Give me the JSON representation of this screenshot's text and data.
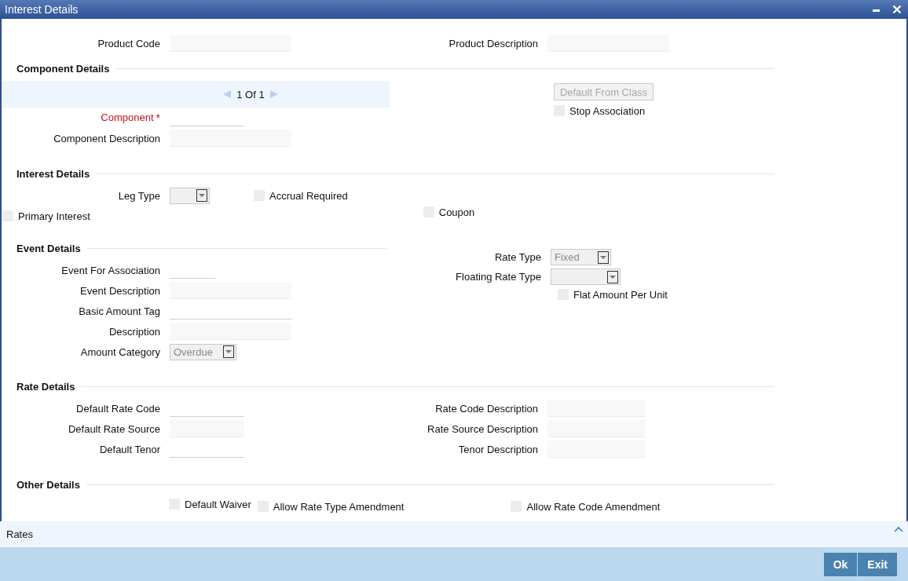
{
  "window": {
    "title": "Interest Details"
  },
  "product": [
    {
      "label": "Product Code",
      "kind": "readonly"
    },
    {
      "label": "Product Description",
      "kind": "readonly"
    }
  ],
  "component_details": {
    "heading": "Component Details",
    "pager": "1 Of 1",
    "fields": [
      {
        "label": "Component",
        "required_mark": "*",
        "kind": "text"
      },
      {
        "label": "Component Description",
        "kind": "readonly"
      }
    ],
    "button": {
      "label": "Default From Class",
      "disabled": true
    },
    "checkboxes": [
      {
        "label": "Stop Association",
        "checked": false
      }
    ]
  },
  "interest_details": {
    "heading": "Interest Details",
    "field": {
      "label": "Leg Type",
      "kind": "select",
      "disabled": true
    },
    "checkboxes": [
      {
        "label": "Accrual Required",
        "checked": false
      },
      {
        "label": "Primary Interest",
        "checked": false
      },
      {
        "label": "Coupon",
        "checked": false
      }
    ]
  },
  "event_details": {
    "heading": "Event Details",
    "fields": [
      {
        "label": "Event For Association",
        "kind": "text"
      },
      {
        "label": "Event Description",
        "kind": "readonly"
      },
      {
        "label": "Basic Amount Tag",
        "kind": "text"
      },
      {
        "label": "Description",
        "kind": "readonly"
      },
      {
        "label": "Amount Category",
        "kind": "select",
        "value": "Overdue",
        "disabled": true
      }
    ],
    "right_fields": [
      {
        "label": "Rate Type",
        "kind": "select",
        "value": "Fixed",
        "disabled": true
      },
      {
        "label": "Floating Rate Type",
        "kind": "select",
        "disabled": true
      }
    ],
    "checkboxes": [
      {
        "label": "Flat Amount Per Unit",
        "checked": false
      }
    ]
  },
  "rate_details": {
    "heading": "Rate Details",
    "left_fields": [
      {
        "label": "Default Rate Code",
        "kind": "text"
      },
      {
        "label": "Default Rate Source",
        "kind": "readonly"
      },
      {
        "label": "Default Tenor",
        "kind": "text"
      }
    ],
    "right_fields": [
      {
        "label": "Rate Code Description",
        "kind": "readonly"
      },
      {
        "label": "Rate Source Description",
        "kind": "readonly"
      },
      {
        "label": "Tenor Description",
        "kind": "readonly"
      }
    ]
  },
  "other_details": {
    "heading": "Other Details",
    "checkboxes": [
      {
        "label": "Default Waiver",
        "checked": false
      },
      {
        "label": "Allow Rate Type Amendment",
        "checked": false
      },
      {
        "label": "Allow Rate Code Amendment",
        "checked": false
      }
    ]
  },
  "rates_bar": {
    "label": "Rates"
  },
  "buttons": [
    {
      "label": "Ok"
    },
    {
      "label": "Exit"
    }
  ]
}
